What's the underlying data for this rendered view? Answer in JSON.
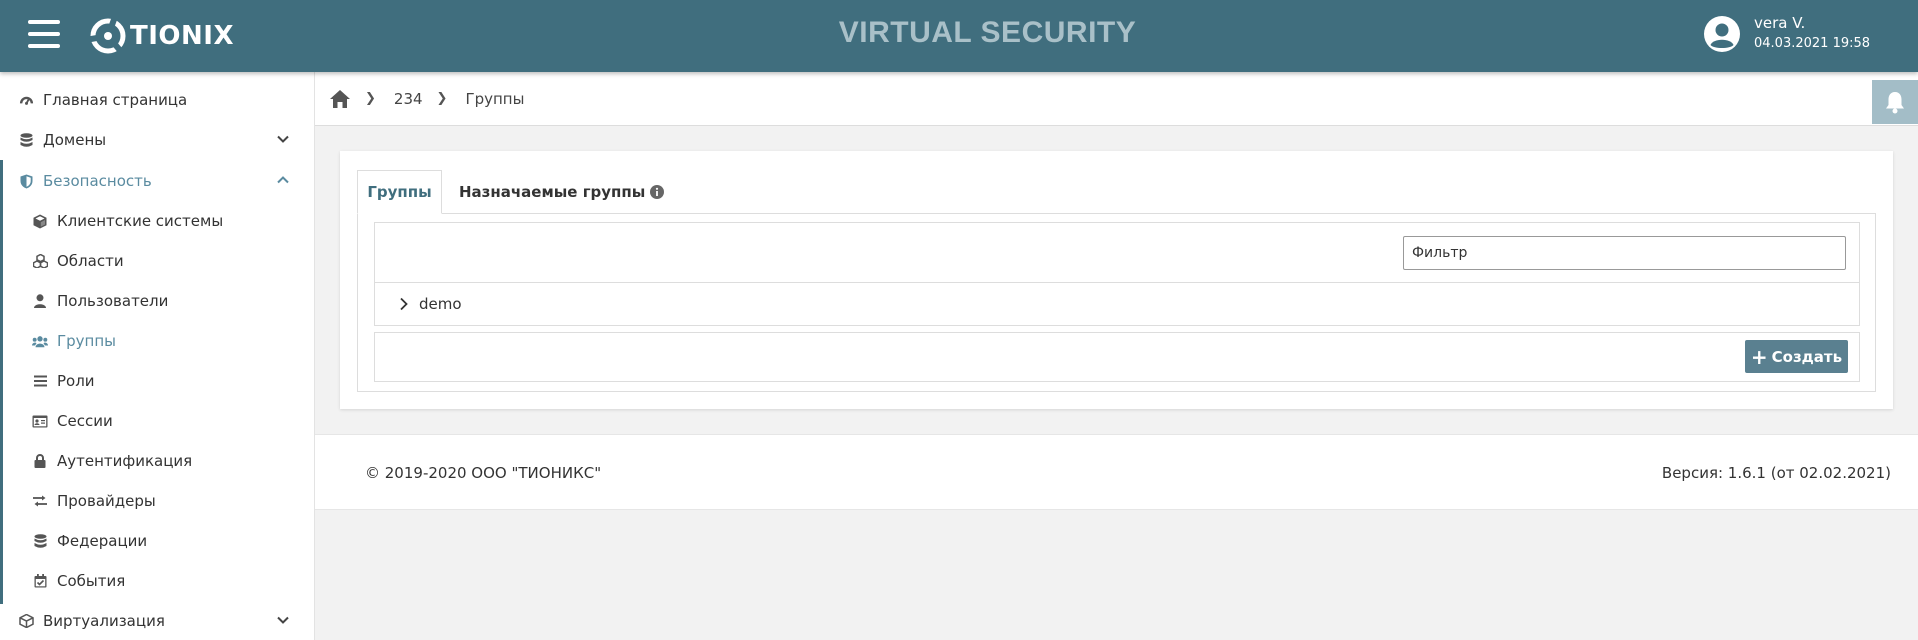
{
  "app": {
    "logo_text": "TIONIX",
    "title": "VIRTUAL SECURITY",
    "accent_color": "#406e7e"
  },
  "user": {
    "name": "vera V.",
    "datetime": "04.03.2021 19:58"
  },
  "sidebar": {
    "items": [
      {
        "label": "Главная страница",
        "icon": "dashboard-icon"
      },
      {
        "label": "Домены",
        "icon": "database-icon",
        "expanded": false
      },
      {
        "label": "Безопасность",
        "icon": "shield-icon",
        "expanded": true
      },
      {
        "label": "Клиентские системы",
        "icon": "cube-icon"
      },
      {
        "label": "Области",
        "icon": "cubes-icon"
      },
      {
        "label": "Пользователи",
        "icon": "user-icon"
      },
      {
        "label": "Группы",
        "icon": "users-icon",
        "active": true
      },
      {
        "label": "Роли",
        "icon": "list-icon"
      },
      {
        "label": "Сессии",
        "icon": "id-card-icon"
      },
      {
        "label": "Аутентификация",
        "icon": "lock-icon"
      },
      {
        "label": "Провайдеры",
        "icon": "exchange-icon"
      },
      {
        "label": "Федерации",
        "icon": "database-icon"
      },
      {
        "label": "События",
        "icon": "calendar-check-icon"
      },
      {
        "label": "Виртуализация",
        "icon": "cubes-icon",
        "expanded": false
      }
    ]
  },
  "breadcrumb": {
    "items": [
      "234",
      "Группы"
    ]
  },
  "tabs": [
    {
      "label": "Группы",
      "active": true
    },
    {
      "label": "Назначаемые группы",
      "active": false
    }
  ],
  "filter": {
    "placeholder": "Фильтр",
    "value": ""
  },
  "tree": {
    "rows": [
      {
        "label": "demo"
      }
    ]
  },
  "actions": {
    "create_label": "Создать"
  },
  "footer": {
    "copyright": "© 2019-2020 ООО \"ТИОНИКС\"",
    "version": "Версия: 1.6.1 (от 02.02.2021)"
  }
}
